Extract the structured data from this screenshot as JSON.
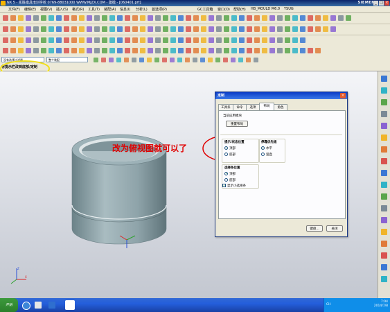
{
  "window": {
    "title": "NX 5 - 凯胜模具培训学校  0769-88031000  WWW.MJZX.COM - 建模 - [060401.prt]",
    "brand": "SIEMENS",
    "controls": [
      "_",
      "□",
      "×"
    ]
  },
  "menu": {
    "items": [
      "文件(F)",
      "编辑(E)",
      "视图(V)",
      "插入(S)",
      "格式(R)",
      "工具(T)",
      "装配(A)",
      "信息(I)",
      "分析(L)",
      "首选项(P)",
      "GC工具箱",
      "窗口(O)",
      "帮助(H)",
      "HB_MOULD M6.0",
      "YSUG"
    ]
  },
  "filter": {
    "type_filter": "没有选择过滤器",
    "scope": "整个装配"
  },
  "cue_line": {
    "text": "将提示栏改到底部/定制"
  },
  "dialog": {
    "title": "定制",
    "close": "×",
    "tabs": [
      "工具条",
      "命令",
      "选项",
      "布局",
      "角色"
    ],
    "active_tab": "布局",
    "current_app_label": "当前应用模块",
    "reset_layout": "重置布局",
    "cue_status_group": {
      "title": "提示/状态位置",
      "options": [
        "顶部",
        "底部"
      ],
      "selected": "顶部"
    },
    "dock_priority_group": {
      "title": "停靠优先级",
      "options": [
        "水平",
        "竖直"
      ],
      "selected": "水平"
    },
    "selection_bar_group": {
      "title": "选择条位置",
      "options": [
        "顶部",
        "底部"
      ],
      "selected": "顶部"
    },
    "show_mini_selection_bar": {
      "label": "显示小选择条",
      "checked": true
    },
    "buttons": {
      "keyboard": "键盘...",
      "close": "关闭"
    }
  },
  "annotation": {
    "text": "改为俯视图就可以了",
    "color": "#e00000"
  },
  "taskbar": {
    "start": "开始",
    "time": "7:04",
    "date": "2014/7/8",
    "ime": "CH"
  },
  "colors": {
    "title_bar": "#0a246a",
    "part_body": "#8fa6ad",
    "highlight_ellipse": "#f2e01a",
    "annotation_circle": "#e00000"
  },
  "icons": [
    "toolbar-icon",
    "snap-icon",
    "view-triad-icon",
    "cylinder-part",
    "resource-bar-icon",
    "ie-icon",
    "nx-icon",
    "tray-icon"
  ]
}
